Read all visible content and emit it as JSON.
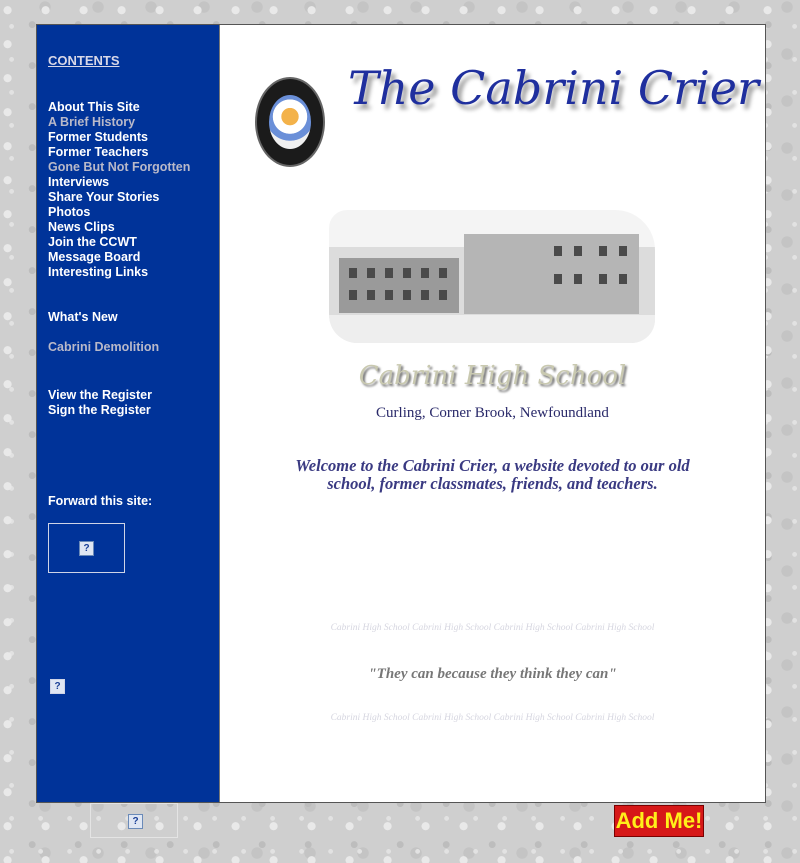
{
  "sidebar": {
    "contents_label": "CONTENTS",
    "menu": [
      {
        "label": "About This Site",
        "dim": false
      },
      {
        "label": "A Brief History",
        "dim": true
      },
      {
        "label": "Former Students",
        "dim": false
      },
      {
        "label": "Former Teachers",
        "dim": false
      },
      {
        "label": "Gone But Not Forgotten",
        "dim": true
      },
      {
        "label": "Interviews",
        "dim": false
      },
      {
        "label": "Share Your Stories",
        "dim": false
      },
      {
        "label": "Photos",
        "dim": false
      },
      {
        "label": "News Clips",
        "dim": false
      },
      {
        "label": "Join the CCWT",
        "dim": false
      },
      {
        "label": "Message Board",
        "dim": false
      },
      {
        "label": "Interesting Links",
        "dim": false
      }
    ],
    "whats_new": "What's New",
    "demolition": "Cabrini Demolition",
    "view_register": "View the Register",
    "sign_register": "Sign the Register",
    "forward_label": "Forward this site:",
    "placeholder_glyph": "?"
  },
  "main": {
    "site_title": "The Cabrini Crier",
    "school_name": "Cabrini High School",
    "location": "Curling, Corner Brook, Newfoundland",
    "welcome": "Welcome to the Cabrini Crier, a website devoted to our  old school, former classmates, friends, and teachers.",
    "watermark": "Cabrini High School Cabrini High School Cabrini High School Cabrini High School",
    "quote": "\"They can because they think they can\""
  },
  "footer": {
    "add_me": "Add Me!"
  },
  "colors": {
    "sidebar_bg": "#003399",
    "title_blue": "#1f2f9e",
    "welcome_text": "#3a3a82",
    "add_me_bg": "#d61818",
    "add_me_text": "#ffef1a"
  }
}
